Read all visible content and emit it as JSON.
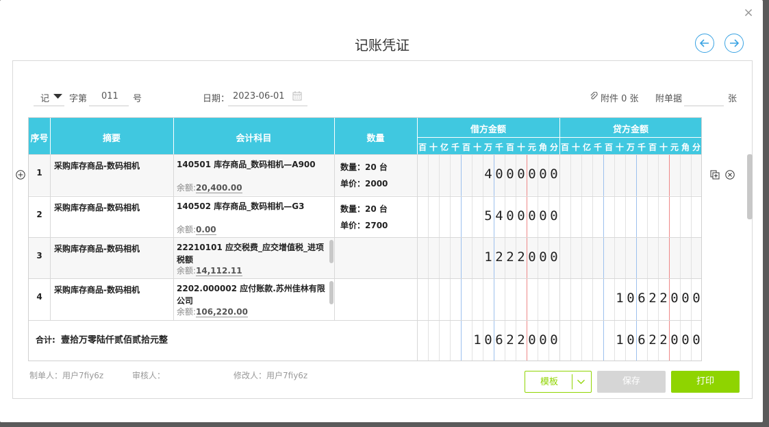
{
  "dialog": {
    "title": "记账凭证",
    "close": "×"
  },
  "voucher": {
    "type": "记",
    "word_label": "字第",
    "number": "011",
    "number_unit": "号",
    "date_label": "日期：",
    "date_value": "2023-06-01",
    "attachment_label": "附件 0 张",
    "attach_docs_label": "附单据",
    "attach_docs_value": "",
    "attach_docs_unit": "张"
  },
  "table": {
    "headers": {
      "seq": "序号",
      "summary": "摘要",
      "account": "会计科目",
      "quantity": "数量",
      "debit": "借方金额",
      "credit": "贷方金额"
    },
    "digit_headers": [
      "百",
      "十",
      "亿",
      "千",
      "百",
      "十",
      "万",
      "千",
      "百",
      "十",
      "元",
      "角",
      "分"
    ],
    "rows": [
      {
        "seq": "1",
        "summary": "采购库存商品-数码相机",
        "account": "140501 库存商品_数码相机—A900",
        "balance_label": "余额:",
        "balance": "20,400.00",
        "qty": "数量：20 台",
        "price": "单价：2000",
        "debit": "4000000",
        "credit": ""
      },
      {
        "seq": "2",
        "summary": "采购库存商品-数码相机",
        "account": "140502 库存商品_数码相机—G3",
        "balance_label": "余额:",
        "balance": "0.00",
        "qty": "数量：20 台",
        "price": "单价：2700",
        "debit": "5400000",
        "credit": ""
      },
      {
        "seq": "3",
        "summary": "采购库存商品-数码相机",
        "account": "22210101 应交税费_应交增值税_进项税额",
        "balance_label": "余额:",
        "balance": "14,112.11",
        "qty": "",
        "price": "",
        "debit": "1222000",
        "credit": ""
      },
      {
        "seq": "4",
        "summary": "采购库存商品-数码相机",
        "account": "2202.000002 应付账款.苏州佳林有限公司",
        "balance_label": "余额:",
        "balance": "106,220.00",
        "qty": "",
        "price": "",
        "debit": "",
        "credit": "10622000"
      }
    ],
    "total_label": "合计:",
    "total_words": "壹拾万零陆仟贰佰贰拾元整",
    "total_debit": "10622000",
    "total_credit": "10622000"
  },
  "footer": {
    "maker": "制单人：用户7fiy6z",
    "reviewer": "审核人：",
    "modifier": "修改人：用户7fiy6z"
  },
  "buttons": {
    "template": "模板",
    "save": "保存",
    "print": "打印"
  },
  "colors": {
    "accent": "#40c8e0",
    "print": "#8fd400",
    "nav": "#3aa3e3"
  }
}
